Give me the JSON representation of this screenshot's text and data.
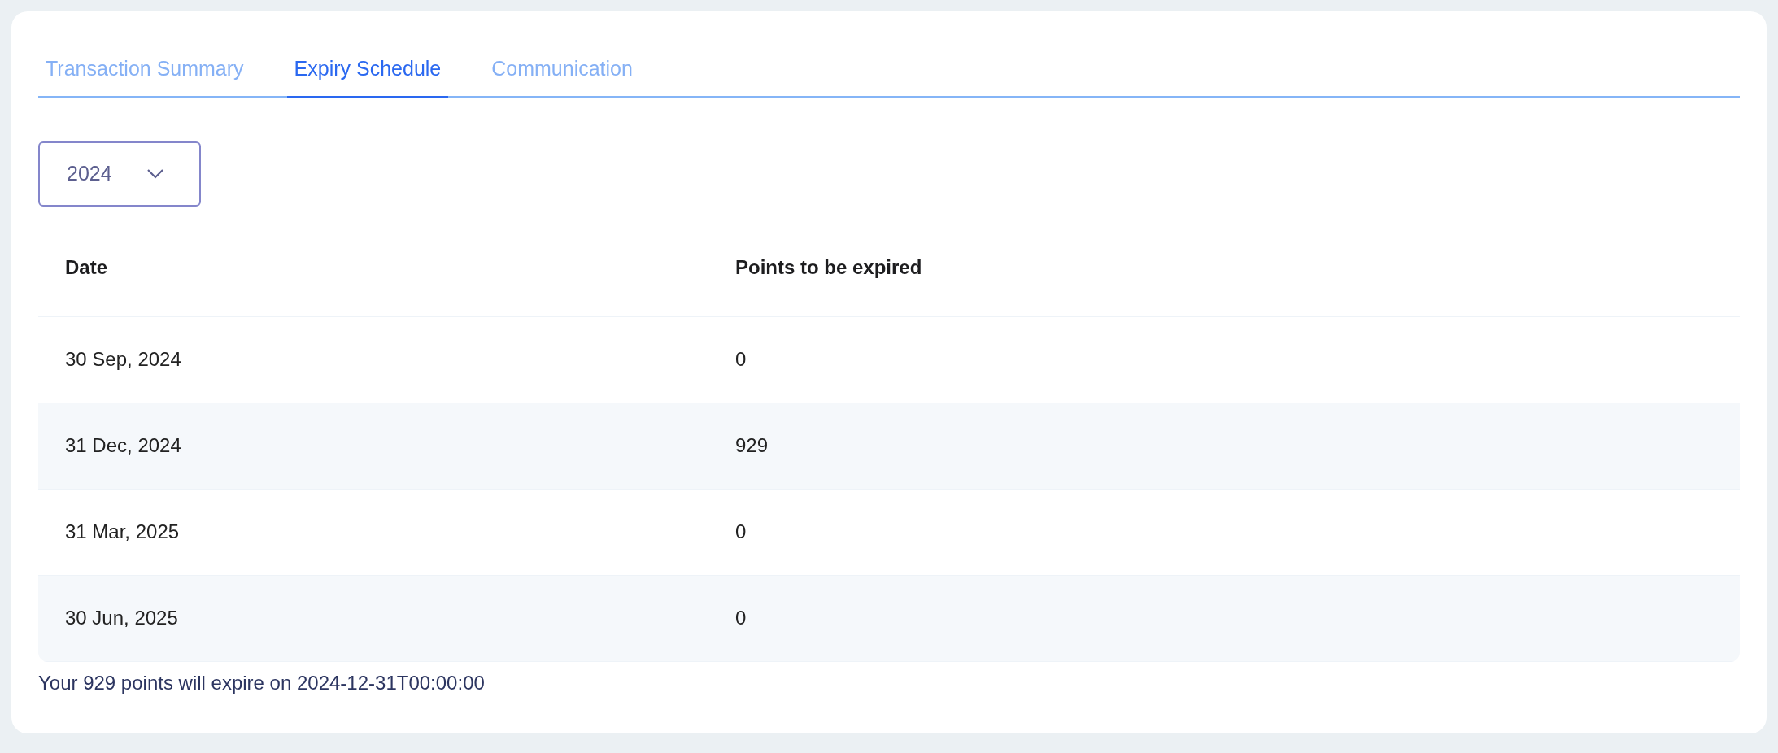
{
  "tabs": [
    {
      "label": "Transaction Summary",
      "selected": false
    },
    {
      "label": "Expiry Schedule",
      "selected": true
    },
    {
      "label": "Communication",
      "selected": false
    }
  ],
  "year_select": {
    "value": "2024"
  },
  "table": {
    "columns": [
      "Date",
      "Points to be expired"
    ],
    "rows": [
      [
        "30 Sep, 2024",
        "0"
      ],
      [
        "31 Dec, 2024",
        "929"
      ],
      [
        "31 Mar, 2025",
        "0"
      ],
      [
        "30 Jun, 2025",
        "0"
      ]
    ]
  },
  "footer_note": "Your 929 points will expire on 2024-12-31T00:00:00"
}
